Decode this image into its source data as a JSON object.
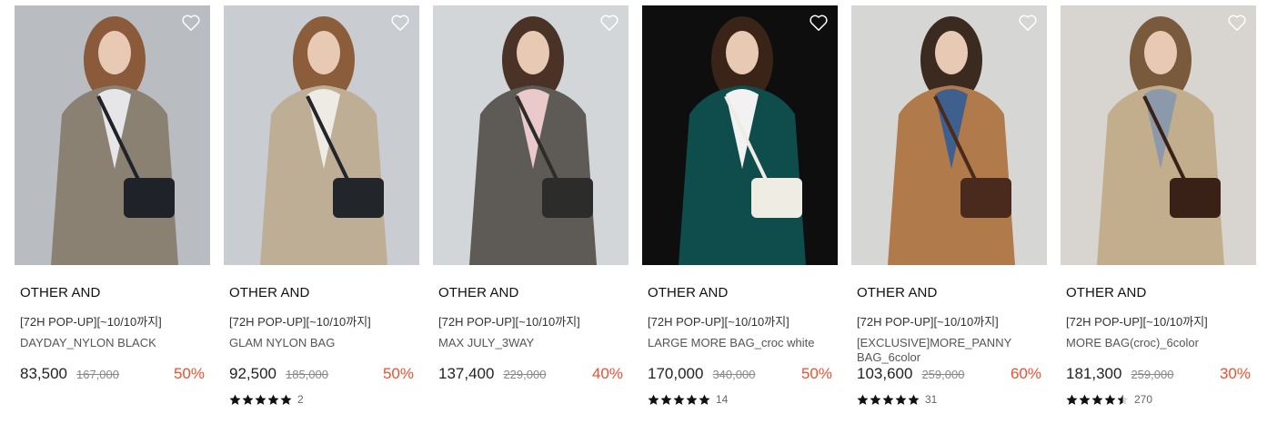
{
  "products": [
    {
      "brand": "OTHER AND",
      "promo": "[72H POP-UP][~10/10까지]",
      "name": "DAYDAY_NYLON BLACK",
      "price": "83,500",
      "original_price": "167,000",
      "discount": "50%",
      "rating": null,
      "review_count": null,
      "colors": {
        "bg": "#b9bdc2",
        "coat": "#8a8172",
        "hair": "#8a5a3a",
        "bag": "#1f2329",
        "inner": "#e6e6e8"
      }
    },
    {
      "brand": "OTHER AND",
      "promo": "[72H POP-UP][~10/10까지]",
      "name": "GLAM NYLON BAG",
      "price": "92,500",
      "original_price": "185,000",
      "discount": "50%",
      "rating": 5,
      "review_count": "2",
      "colors": {
        "bg": "#c9ccd0",
        "coat": "#bfae96",
        "hair": "#8b5d3b",
        "bag": "#22252a",
        "inner": "#eeeae4"
      }
    },
    {
      "brand": "OTHER AND",
      "promo": "[72H POP-UP][~10/10까지]",
      "name": "MAX JULY_3WAY",
      "price": "137,400",
      "original_price": "229,000",
      "discount": "40%",
      "rating": null,
      "review_count": null,
      "colors": {
        "bg": "#d3d6d9",
        "coat": "#5e5a55",
        "hair": "#4a3326",
        "bag": "#2c2d2b",
        "inner": "#e9c9c9"
      }
    },
    {
      "brand": "OTHER AND",
      "promo": "[72H POP-UP][~10/10까지]",
      "name": "LARGE MORE BAG_croc white",
      "price": "170,000",
      "original_price": "340,000",
      "discount": "50%",
      "rating": 5,
      "review_count": "14",
      "colors": {
        "bg": "#0e0e0f",
        "coat": "#0f4d4d",
        "hair": "#3a2418",
        "bag": "#efece4",
        "inner": "#f2f2f2"
      }
    },
    {
      "brand": "OTHER AND",
      "promo": "[72H POP-UP][~10/10까지]",
      "name": "[EXCLUSIVE]MORE_PANNY BAG_6color",
      "price": "103,600",
      "original_price": "259,000",
      "discount": "60%",
      "rating": 5,
      "review_count": "31",
      "colors": {
        "bg": "#d6d6d4",
        "coat": "#b07a4a",
        "hair": "#3b2a20",
        "bag": "#4a2a1c",
        "inner": "#3f5f8f"
      }
    },
    {
      "brand": "OTHER AND",
      "promo": "[72H POP-UP][~10/10까지]",
      "name": "MORE BAG(croc)_6color",
      "price": "181,300",
      "original_price": "259,000",
      "discount": "30%",
      "rating": 4.5,
      "review_count": "270",
      "colors": {
        "bg": "#d8d5d0",
        "coat": "#c2ad8c",
        "hair": "#7a5a3c",
        "bag": "#3a2118",
        "inner": "#8b99ab"
      }
    }
  ]
}
